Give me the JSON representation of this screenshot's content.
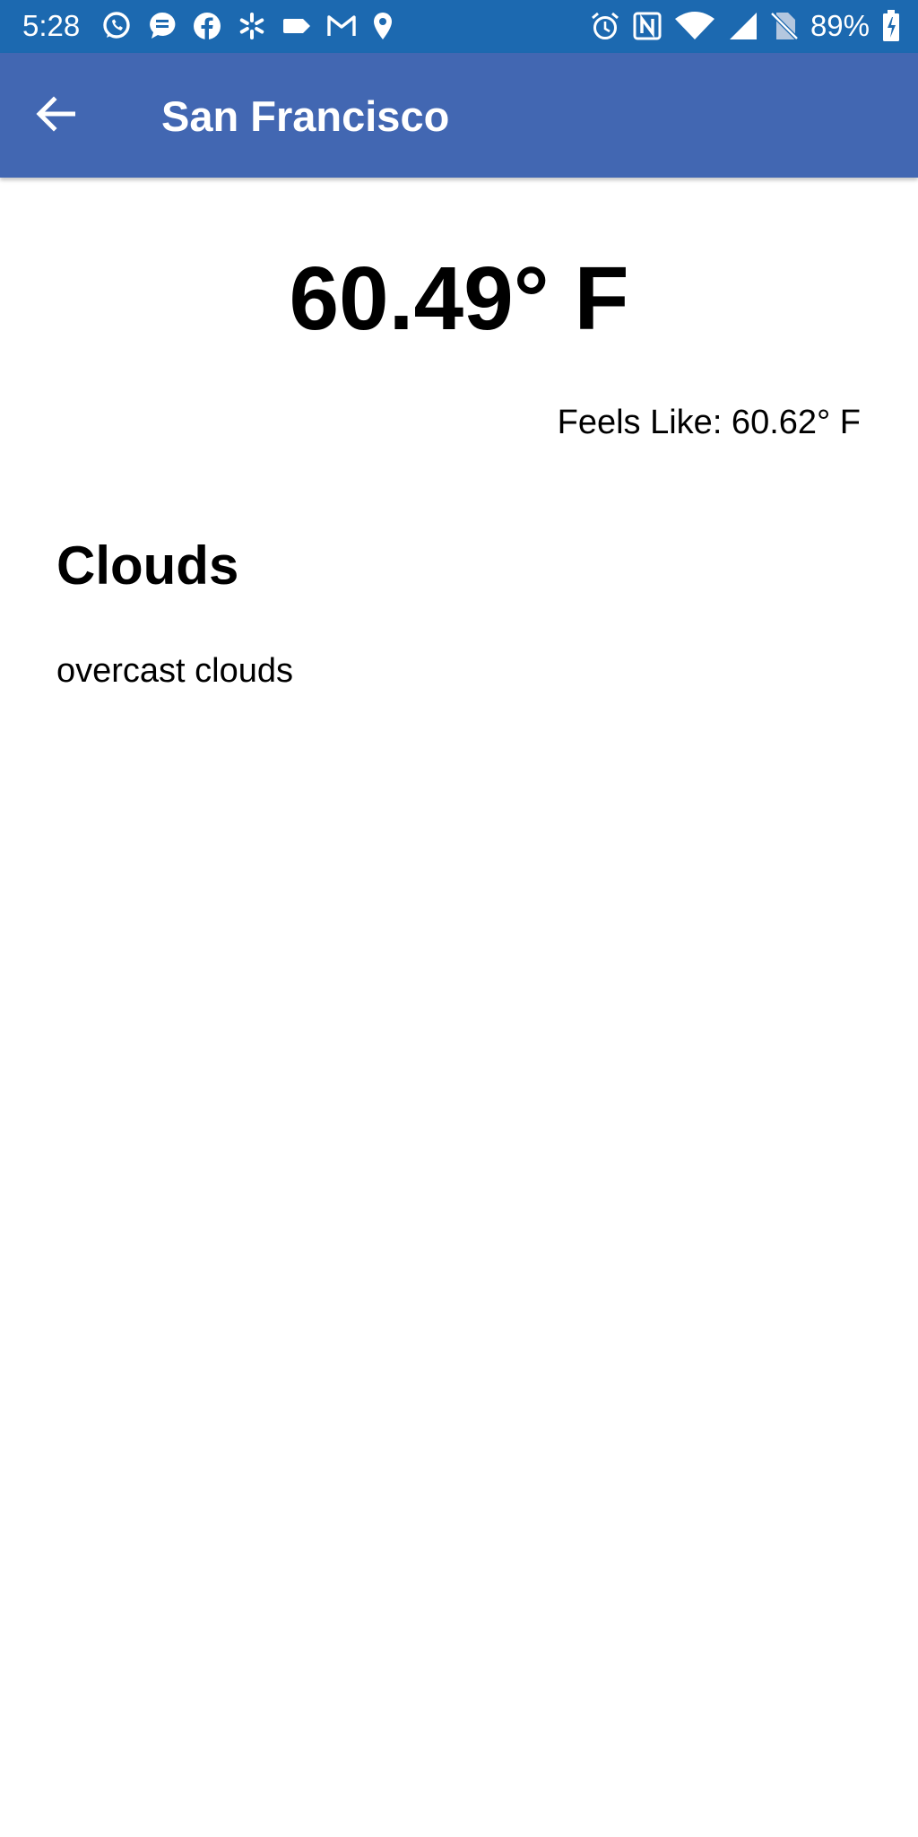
{
  "status_bar": {
    "time": "5:28",
    "battery_percent": "89%",
    "background_color": "#1c69b0",
    "notification_icons": [
      "whatsapp-icon",
      "messaging-icon",
      "facebook-icon",
      "walmart-icon",
      "tag-icon",
      "gmail-icon",
      "location-pin-icon"
    ],
    "system_icons": [
      "alarm-icon",
      "nfc-icon",
      "wifi-icon",
      "signal-icon",
      "no-sim-icon",
      "battery-icon"
    ]
  },
  "app_bar": {
    "title": "San Francisco",
    "back_icon": "arrow-back-icon",
    "background_color": "#4267b2"
  },
  "weather": {
    "temperature": "60.49° F",
    "feels_like": "Feels Like: 60.62° F",
    "condition_main": "Clouds",
    "condition_description": "overcast clouds"
  }
}
